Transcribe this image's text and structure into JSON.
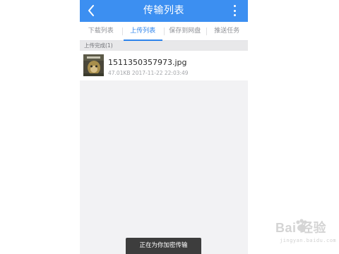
{
  "colors": {
    "accent": "#3c8ff1",
    "tab_active": "#2e84ec",
    "background": "#f2f2f4"
  },
  "header": {
    "back_icon": "chevron-left-icon",
    "title": "传输列表",
    "more_icon": "more-vertical-icon"
  },
  "tabs": [
    {
      "label": "下载列表",
      "active": false
    },
    {
      "label": "上传列表",
      "active": true
    },
    {
      "label": "保存到网盘",
      "active": false
    },
    {
      "label": "推送任务",
      "active": false
    }
  ],
  "section": {
    "label": "上传完成(1)"
  },
  "files": [
    {
      "name": "1511350357973.jpg",
      "meta": "47.01KB 2017-11-22 22:03:49",
      "thumbnail_icon": "image-thumbnail"
    }
  ],
  "toast": {
    "text": "正在为你加密传输"
  },
  "watermark": {
    "main": "Bai 经验",
    "sub": "jingyan.baidu.com"
  }
}
